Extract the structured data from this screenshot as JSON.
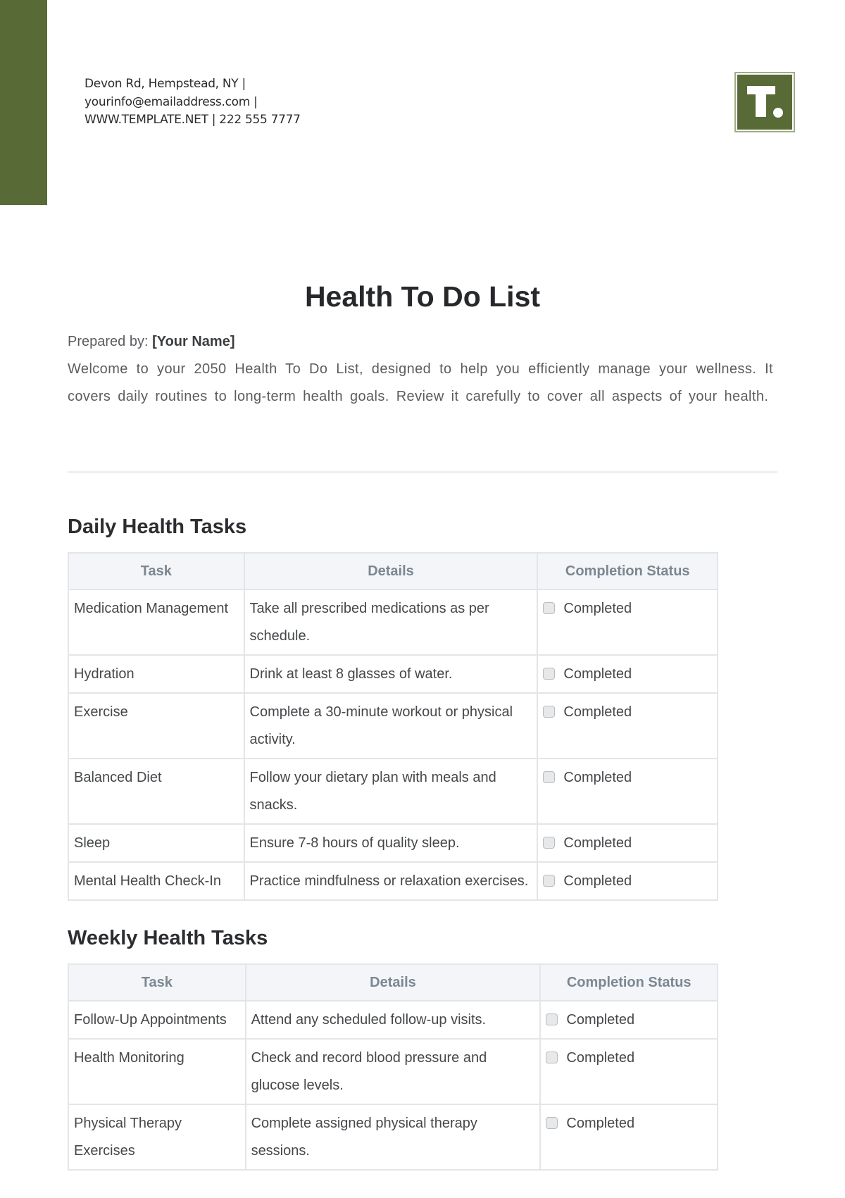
{
  "header": {
    "brand_color": "#586a36",
    "contact_lines": [
      "Devon Rd, Hempstead, NY |",
      "yourinfo@emailaddress.com |",
      "WWW.TEMPLATE.NET | 222 555 7777"
    ],
    "logo_icon": "template-t-logo"
  },
  "document": {
    "title": "Health To Do List",
    "prepared_by_label": "Prepared by:",
    "prepared_by_value": "[Your Name]",
    "intro": "Welcome to your 2050 Health To Do List, designed to help you efficiently manage your wellness. It covers daily routines to long-term health goals. Review it carefully to cover all aspects of your health."
  },
  "daily": {
    "title": "Daily Health Tasks",
    "columns": [
      "Task",
      "Details",
      "Completion Status"
    ],
    "rows": [
      {
        "task": "Medication Management",
        "details": "Take all prescribed medications as per schedule.",
        "status": "Completed",
        "checked": false
      },
      {
        "task": "Hydration",
        "details": "Drink at least 8 glasses of water.",
        "status": "Completed",
        "checked": false
      },
      {
        "task": "Exercise",
        "details": "Complete a 30-minute workout or physical activity.",
        "status": "Completed",
        "checked": false
      },
      {
        "task": "Balanced Diet",
        "details": "Follow your dietary plan with meals and snacks.",
        "status": "Completed",
        "checked": false
      },
      {
        "task": "Sleep",
        "details": "Ensure 7-8 hours of quality sleep.",
        "status": "Completed",
        "checked": false
      },
      {
        "task": "Mental Health Check-In",
        "details": "Practice mindfulness or relaxation exercises.",
        "status": "Completed",
        "checked": false
      }
    ]
  },
  "weekly": {
    "title": "Weekly Health Tasks",
    "columns": [
      "Task",
      "Details",
      "Completion Status"
    ],
    "rows": [
      {
        "task": "Follow-Up Appointments",
        "details": "Attend any scheduled follow-up visits.",
        "status": "Completed",
        "checked": false
      },
      {
        "task": "Health Monitoring",
        "details": "Check and record blood pressure and glucose levels.",
        "status": "Completed",
        "checked": false
      },
      {
        "task": "Physical Therapy Exercises",
        "details": "Complete assigned physical therapy sessions.",
        "status": "Completed",
        "checked": false
      }
    ]
  }
}
